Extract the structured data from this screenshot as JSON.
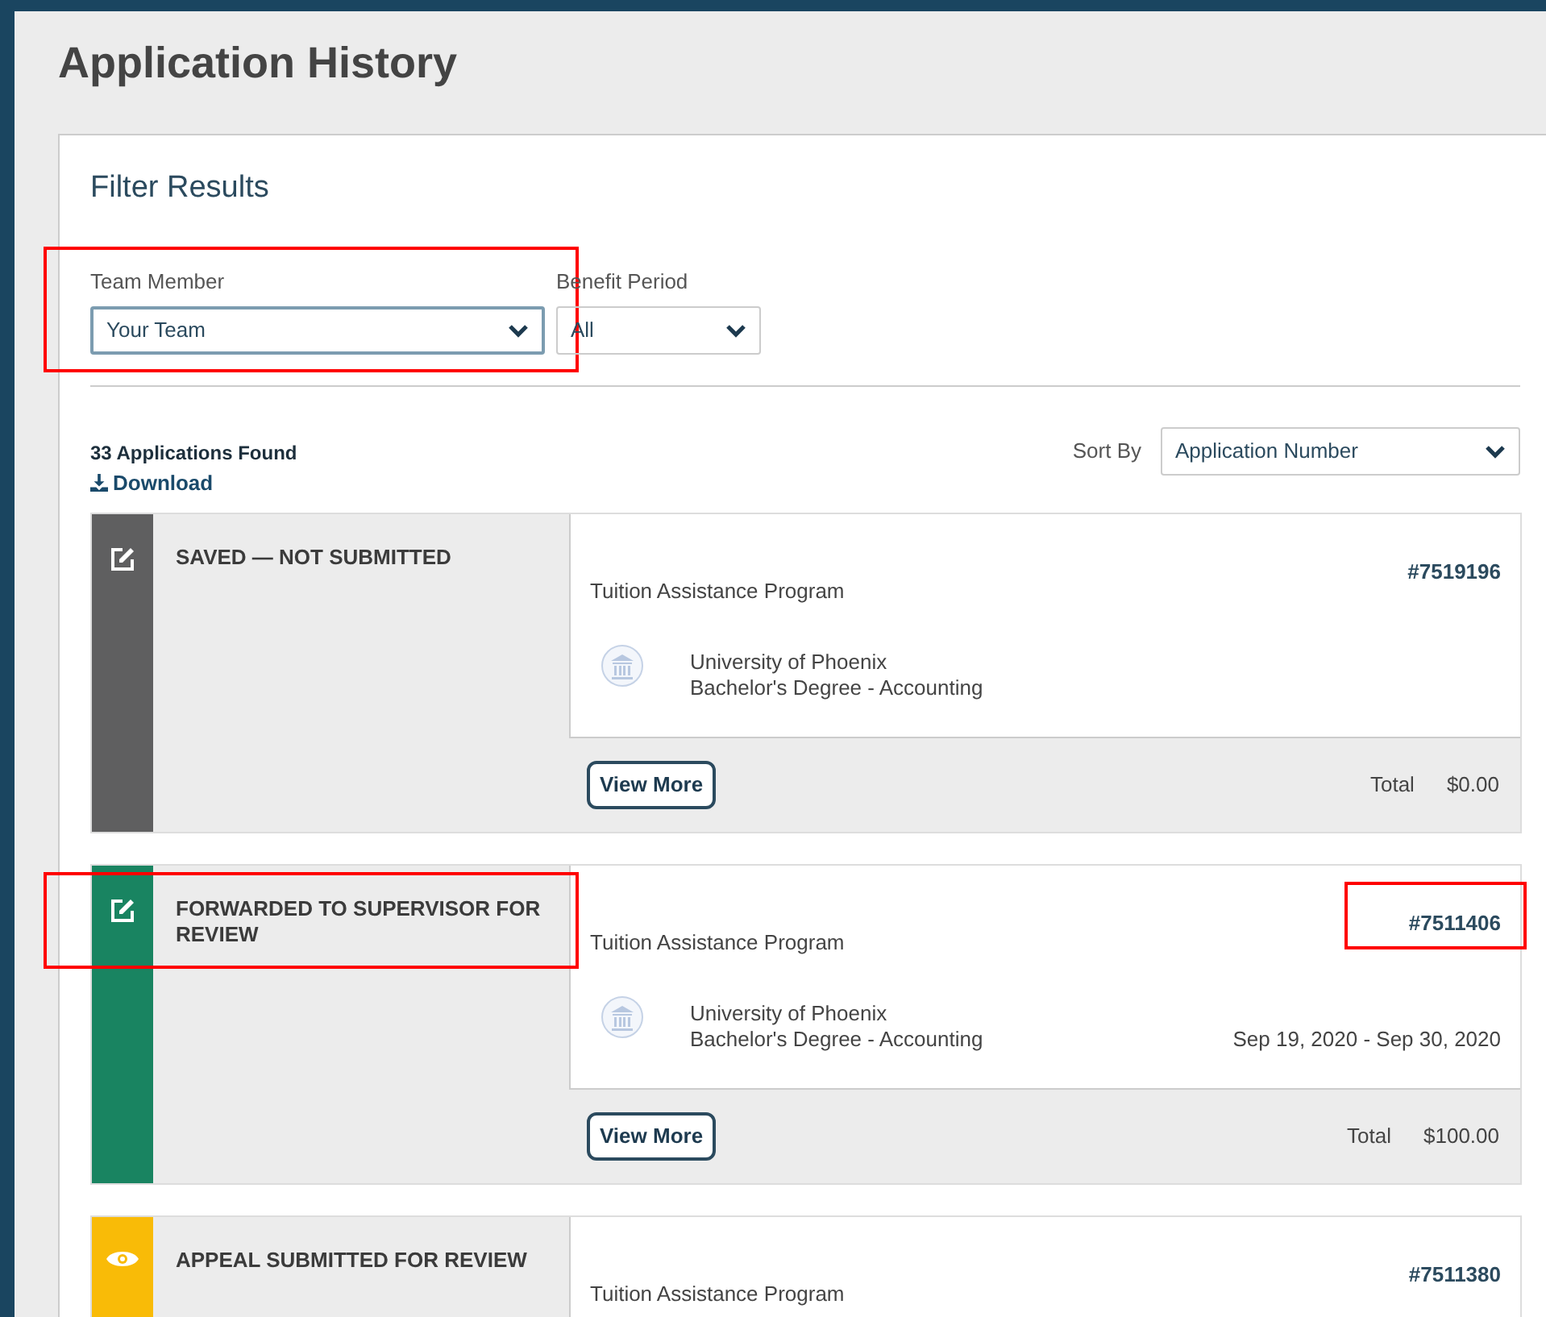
{
  "page_title": "Application History",
  "filter_title": "Filter Results",
  "filters": [
    {
      "label": "Team Member",
      "value": "Your Team",
      "highlighted": true
    },
    {
      "label": "Benefit Period",
      "value": "All"
    }
  ],
  "results_count": "33 Applications Found",
  "download_link": "Download",
  "sort": {
    "label": "Sort By",
    "value": "Application Number"
  },
  "applications": [
    {
      "status": "SAVED — NOT SUBMITTED",
      "color": "#5f5f60",
      "kind": "edit",
      "number": "#7519196",
      "program": "Tuition Assistance Program",
      "school": "University of Phoenix",
      "degree": "Bachelor's Degree - Accounting",
      "button": "View More",
      "total_label": "Total",
      "total": "$0.00"
    },
    {
      "status": "FORWARDED TO SUPERVISOR FOR REVIEW",
      "color": "#198461",
      "kind": "edit",
      "status_highlighted": true,
      "number": "#7511406",
      "number_highlighted": true,
      "program": "Tuition Assistance Program",
      "school": "University of Phoenix",
      "degree": "Bachelor's Degree - Accounting",
      "dates": "Sep 19, 2020 - Sep 30, 2020",
      "button": "View More",
      "total_label": "Total",
      "total": "$100.00"
    },
    {
      "status": "APPEAL SUBMITTED FOR REVIEW",
      "color": "#f9bb07",
      "kind": "eye",
      "number": "#7511380",
      "program": "Tuition Assistance Program"
    }
  ]
}
